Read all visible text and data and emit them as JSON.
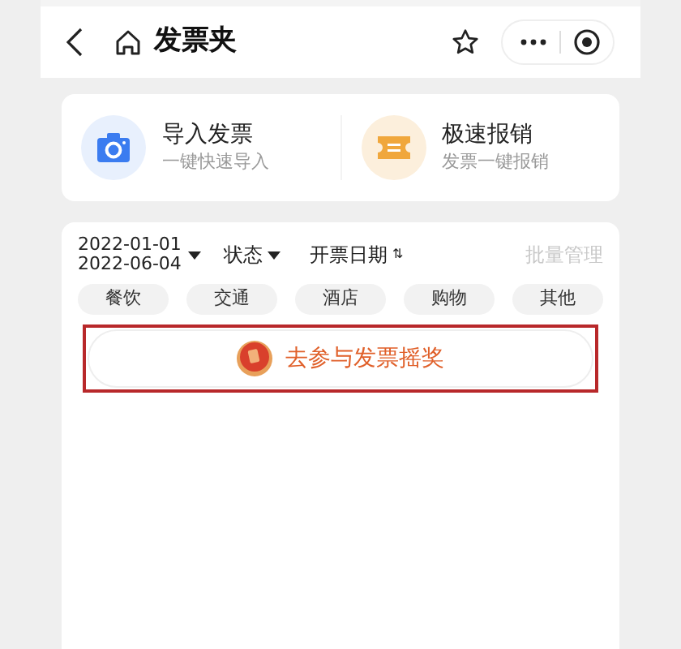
{
  "nav": {
    "title": "发票夹"
  },
  "actions": [
    {
      "kind": "camera",
      "title": "导入发票",
      "subtitle": "一键快速导入"
    },
    {
      "kind": "ticket",
      "title": "极速报销",
      "subtitle": "发票一键报销"
    }
  ],
  "filters": {
    "date_start": "2022-01-01",
    "date_end": "2022-06-04",
    "status": "状态",
    "sort": "开票日期",
    "sort_icon": "⇅",
    "batch": "批量管理"
  },
  "categories": [
    {
      "label": "餐饮"
    },
    {
      "label": "交通"
    },
    {
      "label": "酒店"
    },
    {
      "label": "购物"
    },
    {
      "label": "其他"
    }
  ],
  "lottery": {
    "label": "去参与发票摇奖"
  }
}
